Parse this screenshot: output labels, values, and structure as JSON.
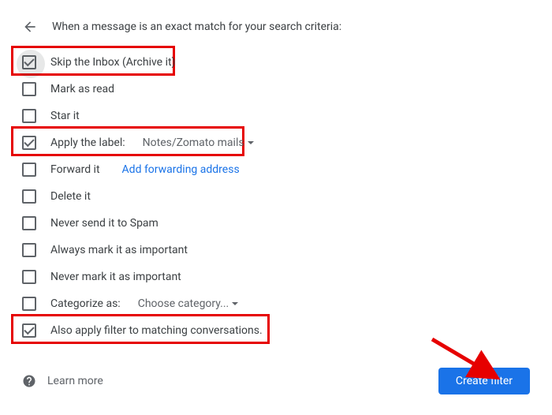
{
  "header": {
    "title": "When a message is an exact match for your search criteria:"
  },
  "options": {
    "skip_inbox": {
      "label": "Skip the Inbox (Archive it)",
      "checked": true
    },
    "mark_read": {
      "label": "Mark as read",
      "checked": false
    },
    "star": {
      "label": "Star it",
      "checked": false
    },
    "apply_label": {
      "label": "Apply the label:",
      "checked": true,
      "value": "Notes/Zomato mails"
    },
    "forward": {
      "label": "Forward it",
      "checked": false,
      "link": "Add forwarding address"
    },
    "delete": {
      "label": "Delete it",
      "checked": false
    },
    "never_spam": {
      "label": "Never send it to Spam",
      "checked": false
    },
    "always_important": {
      "label": "Always mark it as important",
      "checked": false
    },
    "never_important": {
      "label": "Never mark it as important",
      "checked": false
    },
    "categorize": {
      "label": "Categorize as:",
      "checked": false,
      "value": "Choose category..."
    },
    "also_apply": {
      "label": "Also apply filter to matching conversations.",
      "checked": true
    }
  },
  "footer": {
    "learn_more": "Learn more",
    "create_button": "Create filter"
  }
}
